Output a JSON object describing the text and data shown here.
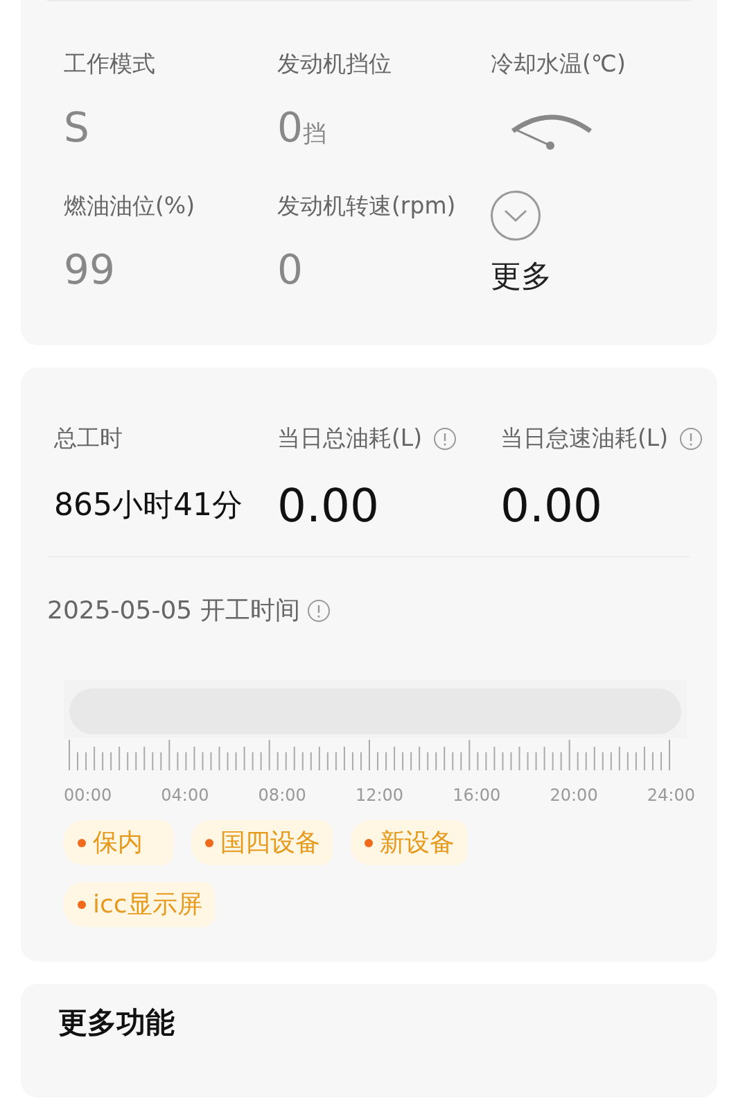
{
  "status_card": {
    "items": [
      {
        "kind": "text",
        "label": "工作模式",
        "value": "S"
      },
      {
        "kind": "text",
        "label": "发动机挡位",
        "value": "0",
        "unit": "挡"
      },
      {
        "kind": "gauge",
        "label": "冷却水温(℃)"
      },
      {
        "kind": "text",
        "label": "燃油油位(%)",
        "value": "99"
      },
      {
        "kind": "text",
        "label": "发动机转速(rpm)",
        "value": "0"
      },
      {
        "kind": "more",
        "label": "更多"
      }
    ]
  },
  "usage_card": {
    "stats": [
      {
        "label": "总工时",
        "value": "865小时41分",
        "info": false
      },
      {
        "label": "当日总油耗(L)",
        "value": "0.00",
        "info": true
      },
      {
        "label": "当日怠速油耗(L)",
        "value": "0.00",
        "info": true
      }
    ],
    "timeline": {
      "title": "2025-05-05 开工时间",
      "ticks": [
        "00:00",
        "04:00",
        "08:00",
        "12:00",
        "16:00",
        "20:00",
        "24:00"
      ]
    },
    "tags": [
      "保内",
      "国四设备",
      "新设备",
      "icc显示屏"
    ]
  },
  "more_card": {
    "title": "更多功能"
  }
}
